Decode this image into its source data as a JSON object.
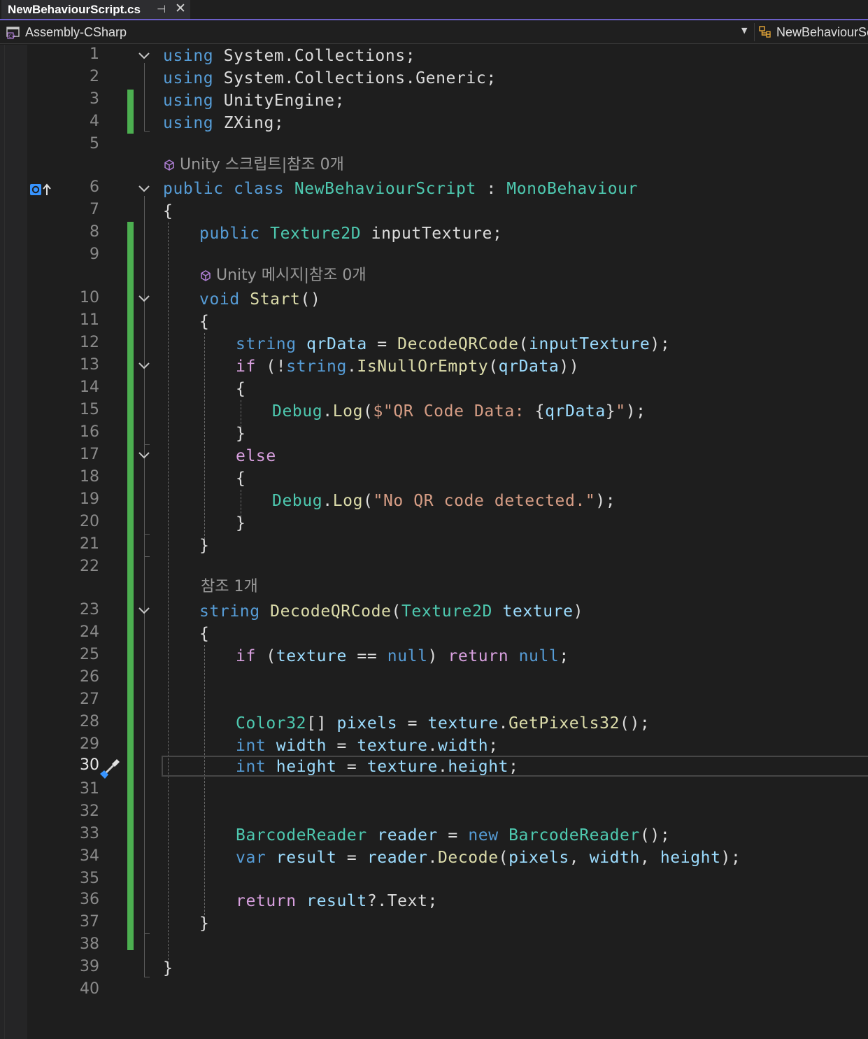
{
  "tab": {
    "title": "NewBehaviourScript.cs",
    "pin_icon": "pin-icon",
    "close_icon": "close-icon"
  },
  "navbar": {
    "project": "Assembly-CSharp",
    "class_name": "NewBehaviourScript"
  },
  "lens": {
    "class_lens": "Unity 스크립트|참조 0개",
    "start_lens": "Unity 메시지|참조 0개",
    "decode_lens": "참조 1개"
  },
  "line_numbers": [
    "1",
    "2",
    "3",
    "4",
    "5",
    "6",
    "7",
    "8",
    "9",
    "10",
    "11",
    "12",
    "13",
    "14",
    "15",
    "16",
    "17",
    "18",
    "19",
    "20",
    "21",
    "22",
    "23",
    "24",
    "25",
    "26",
    "27",
    "28",
    "29",
    "30",
    "31",
    "32",
    "33",
    "34",
    "35",
    "36",
    "37",
    "38",
    "39",
    "40"
  ],
  "code": {
    "l1": [
      "using",
      " System.Collections;"
    ],
    "l2": [
      "using",
      " System.Collections.Generic;"
    ],
    "l3": [
      "using",
      " UnityEngine;"
    ],
    "l4": [
      "using",
      " ZXing;"
    ],
    "l6": [
      "public",
      " ",
      "class",
      " ",
      "NewBehaviourScript",
      " : ",
      "MonoBehaviour"
    ],
    "l7": [
      "{"
    ],
    "l8": [
      "public",
      " ",
      "Texture2D",
      " inputTexture;"
    ],
    "l10": [
      "void",
      " ",
      "Start",
      "()"
    ],
    "l11": [
      "{"
    ],
    "l12": [
      "string",
      " ",
      "qrData",
      " = ",
      "DecodeQRCode",
      "(",
      "inputTexture",
      ");"
    ],
    "l13": [
      "if",
      " (!",
      "string",
      ".",
      "IsNullOrEmpty",
      "(",
      "qrData",
      "))"
    ],
    "l14": [
      "{"
    ],
    "l15": [
      "Debug",
      ".",
      "Log",
      "(",
      "$\"QR Code Data: ",
      "{",
      "qrData",
      "}",
      "\"",
      ");"
    ],
    "l16": [
      "}"
    ],
    "l17": [
      "else"
    ],
    "l18": [
      "{"
    ],
    "l19": [
      "Debug",
      ".",
      "Log",
      "(",
      "\"No QR code detected.\"",
      ");"
    ],
    "l20": [
      "}"
    ],
    "l21": [
      "}"
    ],
    "l23": [
      "string",
      " ",
      "DecodeQRCode",
      "(",
      "Texture2D",
      " ",
      "texture",
      ")"
    ],
    "l24": [
      "{"
    ],
    "l25": [
      "if",
      " (",
      "texture",
      " == ",
      "null",
      ") ",
      "return",
      " ",
      "null",
      ";"
    ],
    "l28": [
      "Color32",
      "[] ",
      "pixels",
      " = ",
      "texture",
      ".",
      "GetPixels32",
      "();"
    ],
    "l29": [
      "int",
      " ",
      "width",
      " = ",
      "texture",
      ".",
      "width",
      ";"
    ],
    "l30": [
      "int",
      " ",
      "height",
      " = ",
      "texture",
      ".",
      "height",
      ";"
    ],
    "l33": [
      "BarcodeReader",
      " ",
      "reader",
      " = ",
      "new",
      " ",
      "BarcodeReader",
      "();"
    ],
    "l34": [
      "var",
      " ",
      "result",
      " = ",
      "reader",
      ".",
      "Decode",
      "(",
      "pixels",
      ", ",
      "width",
      ", ",
      "height",
      ");"
    ],
    "l36": [
      "return",
      " ",
      "result",
      "?.Text;"
    ],
    "l37": [
      "}"
    ],
    "l39": [
      "}"
    ]
  },
  "current_line": "30",
  "colors": {
    "keyword": "#569cd6",
    "control": "#d8a0df",
    "type": "#4ec9b0",
    "method": "#dcdcaa",
    "variable": "#9cdcfe",
    "string": "#d69d85",
    "change_bar": "#4caf50",
    "tab_accent": "#6c5fc7"
  }
}
